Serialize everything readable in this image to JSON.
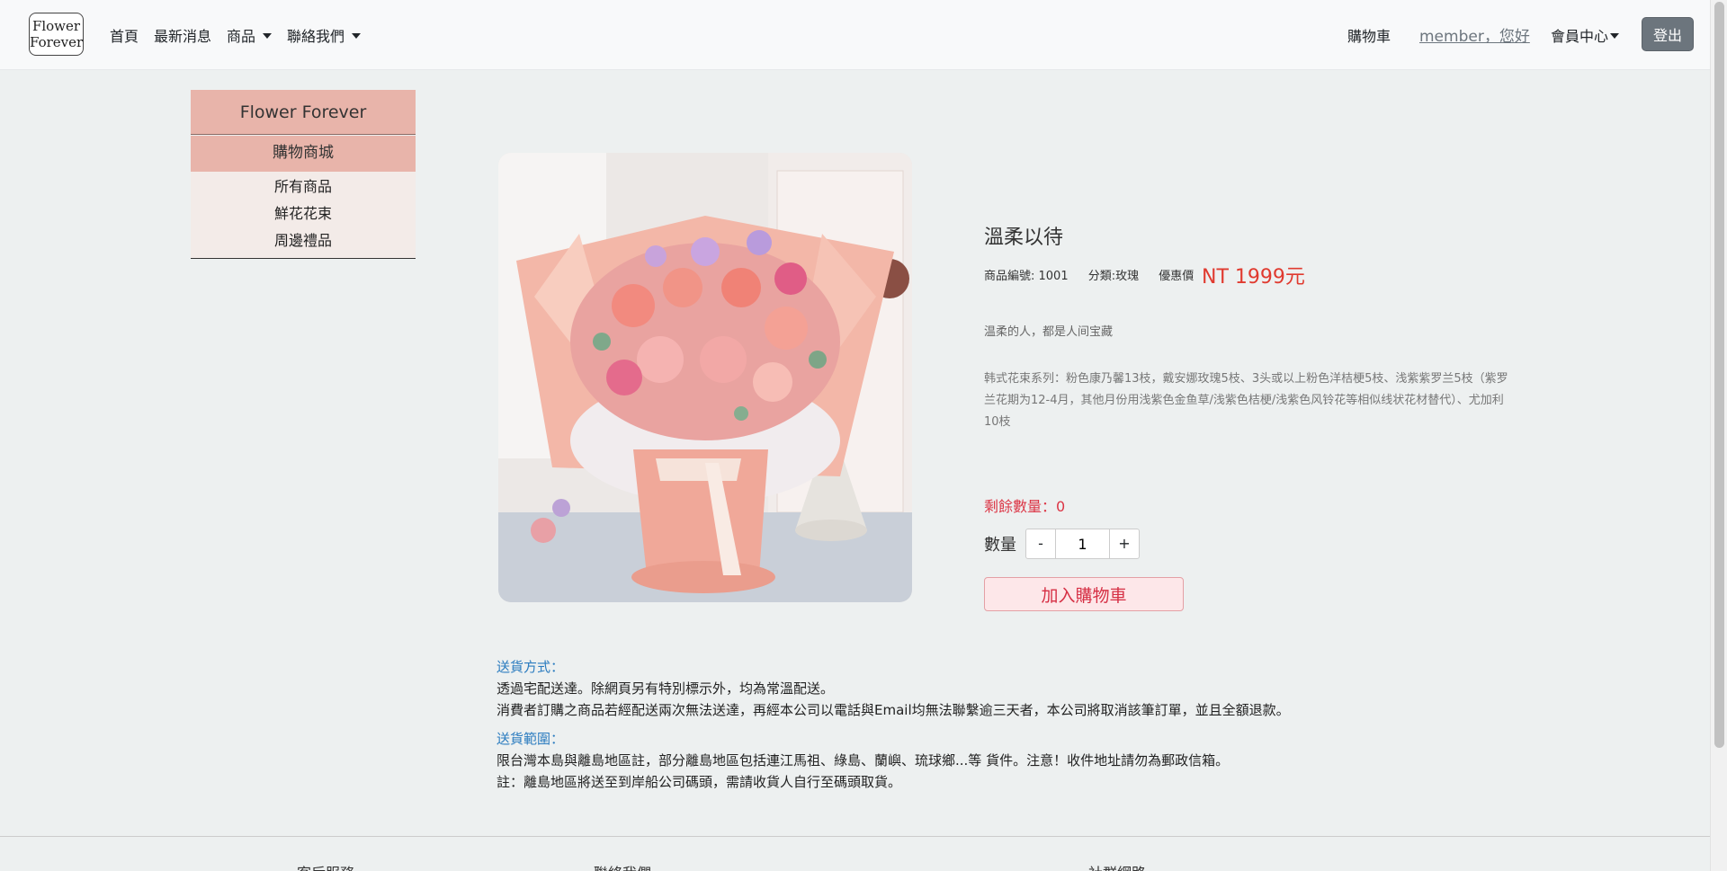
{
  "navbar": {
    "logo_line1": "Flower",
    "logo_line2": "Forever",
    "links": [
      "首頁",
      "最新消息",
      "商品",
      "聯絡我們"
    ],
    "cart": "購物車",
    "member": "member，您好",
    "member_center": "會員中心",
    "logout": "登出"
  },
  "sidebar": {
    "title": "Flower Forever",
    "section": "購物商城",
    "items": [
      "所有商品",
      "鮮花花束",
      "周邊禮品"
    ]
  },
  "product": {
    "name": "溫柔以待",
    "id_label": "商品編號: 1001",
    "category_label": "分類:玫瑰",
    "discount_label": "優惠價",
    "price": "NT 1999元",
    "tagline": "温柔的人，都是人间宝藏",
    "description": "韩式花束系列：粉色康乃馨13枝，戴安娜玫瑰5枝、3头或以上粉色洋桔梗5枝、浅紫紫罗兰5枝（紫罗兰花期为12-4月，其他月份用浅紫色金鱼草/浅紫色桔梗/浅紫色风铃花等相似线状花材替代）、尤加利10枝",
    "stock": "剩餘數量：0",
    "qty_label": "數量",
    "qty_minus": "-",
    "qty_value": "1",
    "qty_plus": "+",
    "add_to_cart": "加入購物車"
  },
  "shipping": {
    "method_title": "送貨方式：",
    "method_line1": "透過宅配送達。除網頁另有特別標示外，均為常溫配送。",
    "method_line2": "消費者訂購之商品若經配送兩次無法送達，再經本公司以電話與Email均無法聯繫逾三天者，本公司將取消該筆訂單，並且全額退款。",
    "range_title": "送貨範圍：",
    "range_line1": "限台灣本島與離島地區註，部分離島地區包括連江馬祖、綠島、蘭嶼、琉球鄉...等 貨件。注意！收件地址請勿為郵政信箱。",
    "range_line2": "註：離島地區將送至到岸船公司碼頭，需請收貨人自行至碼頭取貨。"
  },
  "footer": {
    "col1": "客后服務",
    "col2": "聯絡我們",
    "col3": "社群網路"
  },
  "colors": {
    "sidebar_accent": "#e8b4aa",
    "price": "#e03a2f",
    "stock": "#dc3545",
    "link_blue": "#2a7bbf"
  }
}
